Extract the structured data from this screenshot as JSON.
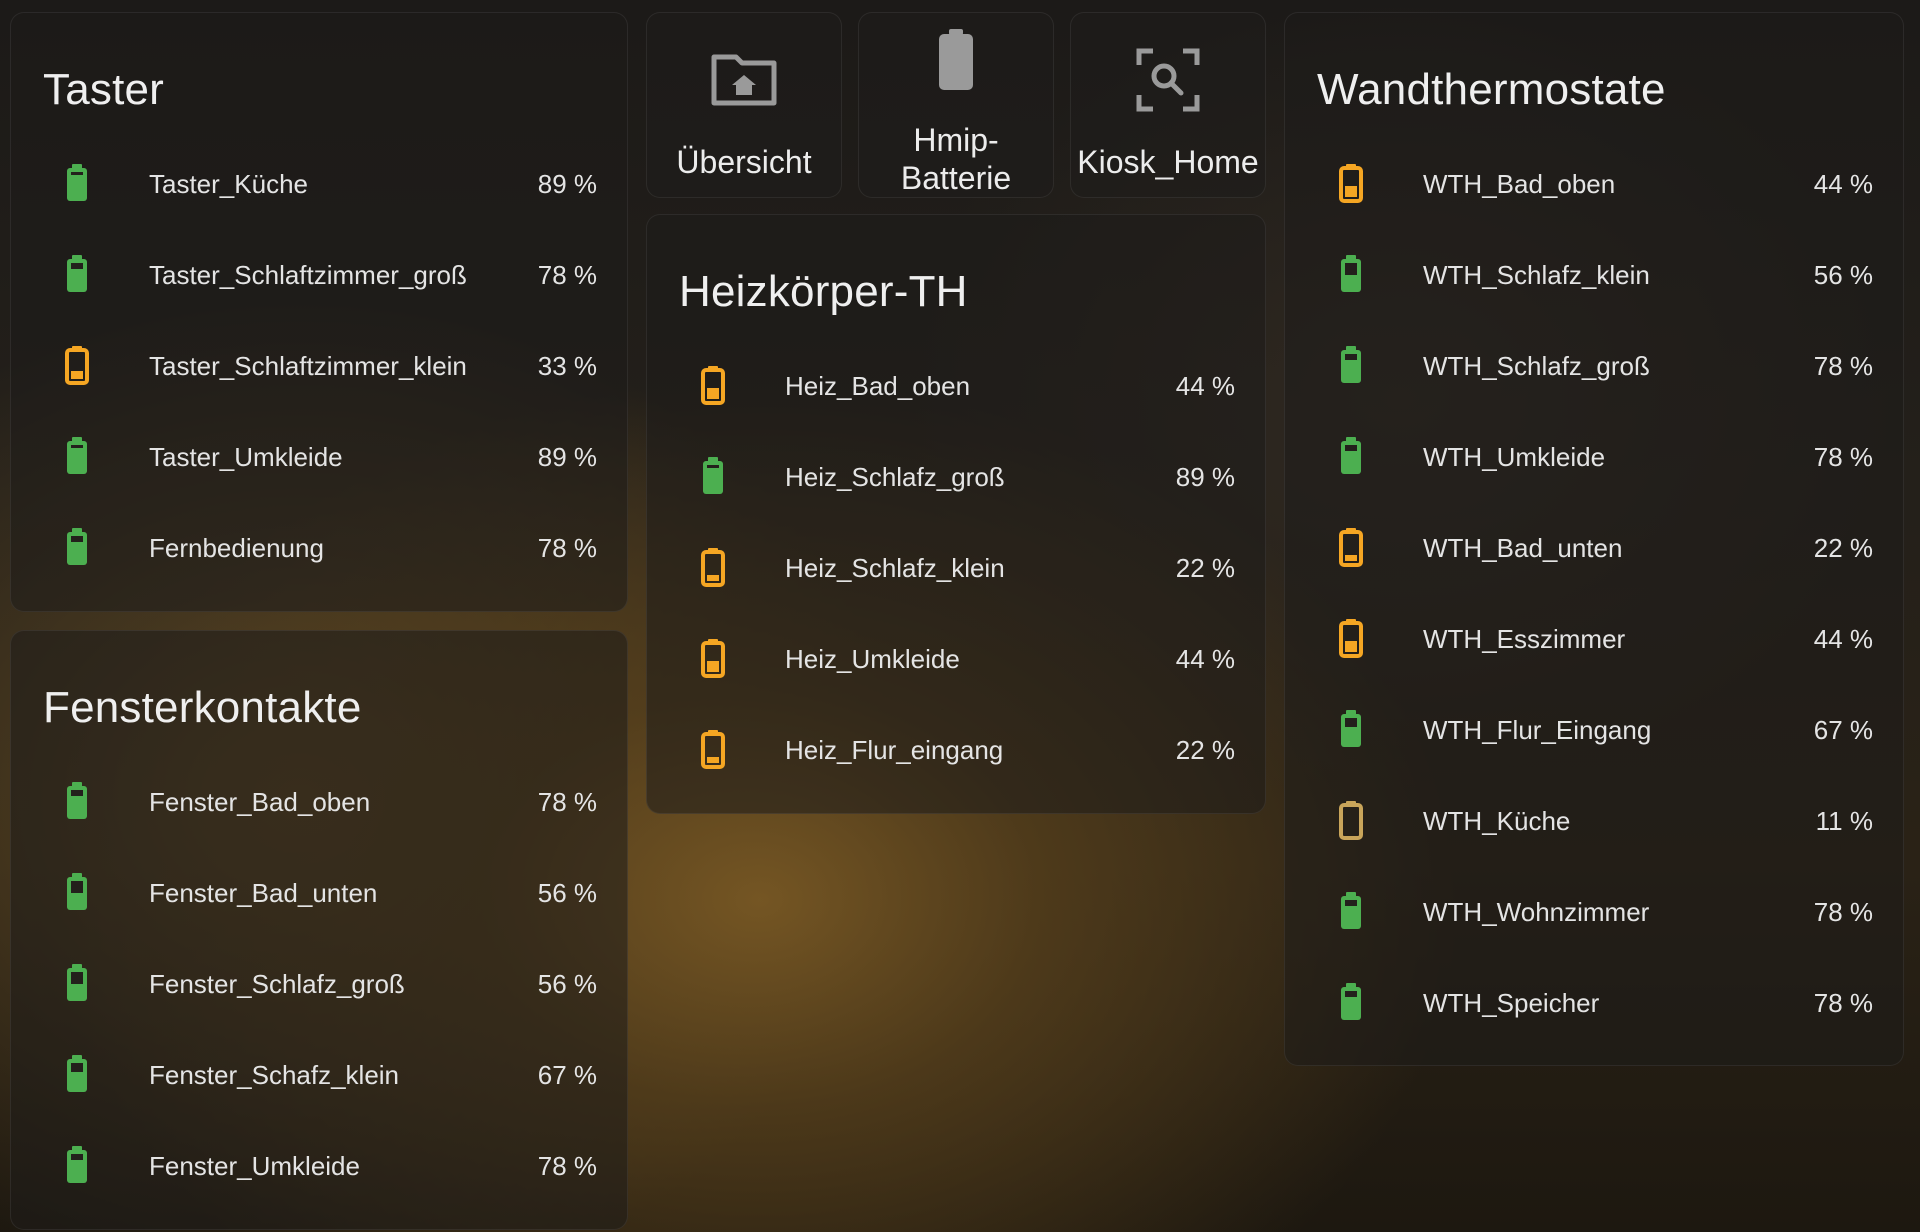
{
  "colors": {
    "good": "#4caf50",
    "low": "#f5a623",
    "critical": "#c9a55a",
    "text": "#e4e4e4"
  },
  "nav": [
    {
      "label": "Übersicht",
      "icon": "folder-home-icon"
    },
    {
      "label": "Hmip-Batterie",
      "label_lines": [
        "Hmip-",
        "Batterie"
      ],
      "icon": "battery-icon"
    },
    {
      "label": "Kiosk_Home",
      "icon": "search-scan-icon"
    }
  ],
  "taster": {
    "title": "Taster",
    "items": [
      {
        "name": "Taster_Küche",
        "value": "89 %",
        "level": "good"
      },
      {
        "name": "Taster_Schlaftzimmer_groß",
        "value": "78 %",
        "level": "good"
      },
      {
        "name": "Taster_Schlaftzimmer_klein",
        "value": "33 %",
        "level": "low"
      },
      {
        "name": "Taster_Umkleide",
        "value": "89 %",
        "level": "good"
      },
      {
        "name": "Fernbedienung",
        "value": "78 %",
        "level": "good"
      }
    ]
  },
  "fenster": {
    "title": "Fensterkontakte",
    "items": [
      {
        "name": "Fenster_Bad_oben",
        "value": "78 %",
        "level": "good"
      },
      {
        "name": "Fenster_Bad_unten",
        "value": "56 %",
        "level": "good"
      },
      {
        "name": "Fenster_Schlafz_groß",
        "value": "56 %",
        "level": "good"
      },
      {
        "name": "Fenster_Schafz_klein",
        "value": "67 %",
        "level": "good"
      },
      {
        "name": "Fenster_Umkleide",
        "value": "78 %",
        "level": "good"
      }
    ]
  },
  "heiz": {
    "title": "Heizkörper-TH",
    "items": [
      {
        "name": "Heiz_Bad_oben",
        "value": "44 %",
        "level": "low"
      },
      {
        "name": "Heiz_Schlafz_groß",
        "value": "89 %",
        "level": "good"
      },
      {
        "name": "Heiz_Schlafz_klein",
        "value": "22 %",
        "level": "low"
      },
      {
        "name": "Heiz_Umkleide",
        "value": "44 %",
        "level": "low"
      },
      {
        "name": "Heiz_Flur_eingang",
        "value": "22 %",
        "level": "low"
      }
    ]
  },
  "wth": {
    "title": "Wandthermostate",
    "items": [
      {
        "name": "WTH_Bad_oben",
        "value": "44 %",
        "level": "low"
      },
      {
        "name": "WTH_Schlafz_klein",
        "value": "56 %",
        "level": "good"
      },
      {
        "name": "WTH_Schlafz_groß",
        "value": "78 %",
        "level": "good"
      },
      {
        "name": "WTH_Umkleide",
        "value": "78 %",
        "level": "good"
      },
      {
        "name": "WTH_Bad_unten",
        "value": "22 %",
        "level": "low"
      },
      {
        "name": "WTH_Esszimmer",
        "value": "44 %",
        "level": "low"
      },
      {
        "name": "WTH_Flur_Eingang",
        "value": "67 %",
        "level": "good"
      },
      {
        "name": "WTH_Küche",
        "value": "11 %",
        "level": "critical"
      },
      {
        "name": "WTH_Wohnzimmer",
        "value": "78 %",
        "level": "good"
      },
      {
        "name": "WTH_Speicher",
        "value": "78 %",
        "level": "good"
      }
    ]
  }
}
